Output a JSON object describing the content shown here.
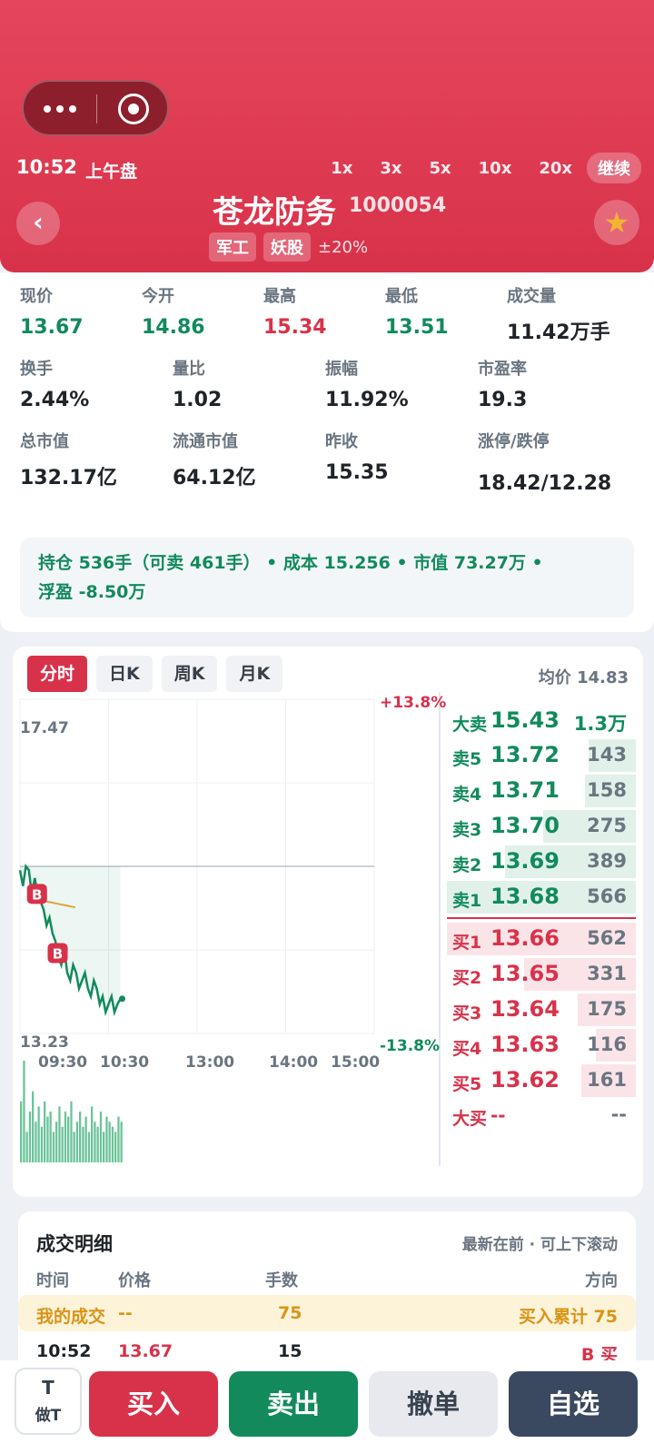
{
  "header": {
    "time": "10:52",
    "session": "上午盘",
    "speeds": [
      "1x",
      "3x",
      "5x",
      "10x",
      "20x"
    ],
    "continue_label": "继续",
    "back_glyph": "‹",
    "star_glyph": "★",
    "stock_name": "苍龙防务",
    "stock_code": "1000054",
    "tags": [
      "军工",
      "妖股"
    ],
    "limit": "±20%"
  },
  "quote": {
    "row1": [
      {
        "label": "现价",
        "value": "13.67",
        "color": "green"
      },
      {
        "label": "今开",
        "value": "14.86",
        "color": "green"
      },
      {
        "label": "最高",
        "value": "15.34",
        "color": "red"
      },
      {
        "label": "最低",
        "value": "13.51",
        "color": "green"
      },
      {
        "label": "成交量",
        "value": "11.42万手",
        "color": "black"
      }
    ],
    "row2": [
      {
        "label": "换手",
        "value": "2.44%"
      },
      {
        "label": "量比",
        "value": "1.02"
      },
      {
        "label": "振幅",
        "value": "11.92%"
      },
      {
        "label": "市盈率",
        "value": "19.3"
      }
    ],
    "row3": [
      {
        "label": "总市值",
        "value": "132.17亿"
      },
      {
        "label": "流通市值",
        "value": "64.12亿"
      },
      {
        "label": "昨收",
        "value": "15.35"
      },
      {
        "label": "涨停/跌停",
        "value": "18.42/12.28"
      }
    ],
    "position_line1": "持仓 536手（可卖 461手） • 成本 15.256 • 市值 73.27万 •",
    "position_line2": "浮盈 -8.50万"
  },
  "chart": {
    "tabs": [
      "分时",
      "日K",
      "周K",
      "月K"
    ],
    "active_tab": "分时",
    "avg_price": "均价 14.83",
    "y_max": "17.47",
    "y_min": "13.23",
    "pct_max": "+13.8%",
    "pct_min": "-13.8%",
    "x_ticks": [
      "09:30",
      "10:30",
      "13:00",
      "14:00",
      "15:00"
    ],
    "marker_label": "B"
  },
  "chart_data": {
    "type": "line",
    "prev_close": 15.35,
    "ylim": [
      13.23,
      17.47
    ],
    "x_ticks": [
      "09:30",
      "10:30",
      "13:00",
      "14:00",
      "15:00"
    ],
    "series": [],
    "price": [
      15.3,
      15.1,
      15.35,
      15.3,
      15.0,
      15.2,
      15.0,
      14.9,
      14.8,
      14.6,
      14.7,
      14.5,
      14.4,
      14.2,
      14.1,
      14.3,
      14.0,
      13.9,
      14.1,
      14.0,
      13.8,
      13.9,
      14.0,
      13.8,
      13.7,
      13.9,
      13.8,
      13.6,
      13.7,
      13.5,
      13.6,
      13.7,
      13.5,
      13.6,
      13.67
    ],
    "avg": [
      14.95,
      14.94,
      14.93,
      14.92,
      14.91,
      14.9,
      14.89,
      14.88,
      14.87,
      14.86,
      14.85,
      14.84,
      14.83
    ],
    "buy_markers": [
      {
        "index": 3,
        "price": 15.0
      },
      {
        "index": 10,
        "price": 14.25
      }
    ],
    "volume": [
      0.6,
      1.0,
      0.3,
      0.5,
      0.7,
      0.4,
      0.55,
      0.35,
      0.6,
      0.45,
      0.5,
      0.3,
      0.4,
      0.55,
      0.35,
      0.5,
      0.45,
      0.6,
      0.3,
      0.4,
      0.5,
      0.35,
      0.45,
      0.3,
      0.55,
      0.4,
      0.35,
      0.5,
      0.3,
      0.45,
      0.4,
      0.35,
      0.3,
      0.45,
      0.4
    ]
  },
  "orderbook": {
    "top_sell": {
      "label": "大卖",
      "price": "15.43",
      "vol": "1.3万"
    },
    "sells": [
      {
        "label": "卖5",
        "price": "13.72",
        "vol": "143",
        "depth": 0.25
      },
      {
        "label": "卖4",
        "price": "13.71",
        "vol": "158",
        "depth": 0.27
      },
      {
        "label": "卖3",
        "price": "13.70",
        "vol": "275",
        "depth": 0.49
      },
      {
        "label": "卖2",
        "price": "13.69",
        "vol": "389",
        "depth": 0.69
      },
      {
        "label": "卖1",
        "price": "13.68",
        "vol": "566",
        "depth": 1.0
      }
    ],
    "buys": [
      {
        "label": "买1",
        "price": "13.66",
        "vol": "562",
        "depth": 1.0
      },
      {
        "label": "买2",
        "price": "13.65",
        "vol": "331",
        "depth": 0.59
      },
      {
        "label": "买3",
        "price": "13.64",
        "vol": "175",
        "depth": 0.31
      },
      {
        "label": "买4",
        "price": "13.63",
        "vol": "116",
        "depth": 0.21
      },
      {
        "label": "买5",
        "price": "13.62",
        "vol": "161",
        "depth": 0.29
      }
    ],
    "top_buy": {
      "label": "大买",
      "price": "--",
      "vol": "--"
    }
  },
  "trades": {
    "title": "成交明细",
    "hint": "最新在前 · 可上下滚动",
    "headers": {
      "time": "时间",
      "price": "价格",
      "volume": "手数",
      "direction": "方向"
    },
    "mine": {
      "label": "我的成交",
      "price": "--",
      "volume": "75",
      "direction": "买入累计 75"
    },
    "rows": [
      {
        "time": "10:52",
        "price": "13.67",
        "volume": "15",
        "direction": "B 买"
      }
    ]
  },
  "actions": {
    "t_top": "T",
    "t_bottom": "做T",
    "buy": "买入",
    "sell": "卖出",
    "cancel": "撤单",
    "watch": "自选"
  },
  "colors": {
    "red": "#d8324a",
    "green": "#128a5c",
    "gray_button": "#e7e9ee",
    "dark_button": "#3a4860"
  }
}
